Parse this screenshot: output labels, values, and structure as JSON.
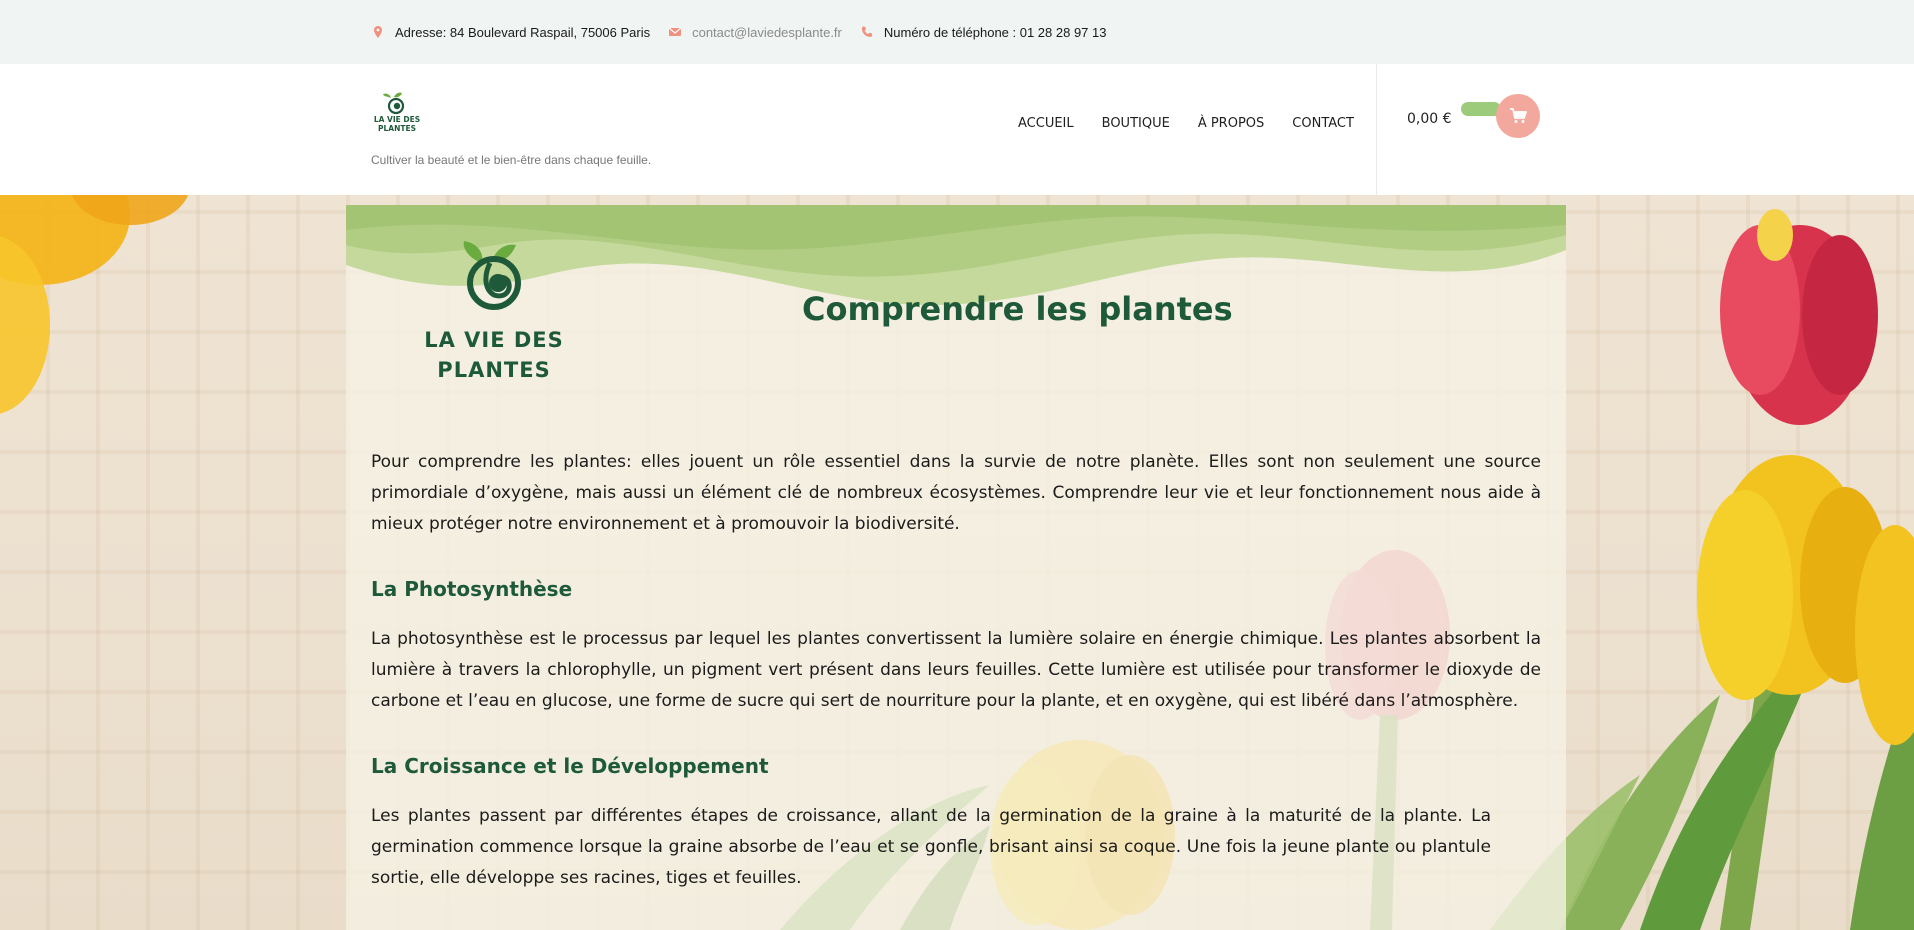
{
  "topbar": {
    "address": "Adresse: 84 Boulevard Raspail, 75006 Paris",
    "email": "contact@laviedesplante.fr",
    "phone": "Numéro de téléphone : 01 28 28 97 13"
  },
  "header": {
    "logo_text": "LA VIE DES PLANTES",
    "tagline": "Cultiver la beauté et le bien-être dans chaque feuille.",
    "nav": [
      "ACCUEIL",
      "BOUTIQUE",
      "À PROPOS",
      "CONTACT"
    ],
    "cart_total": "0,00 €"
  },
  "page": {
    "logo_line1": "LA VIE DES",
    "logo_line2": "PLANTES",
    "title": "Comprendre les plantes",
    "intro": "Pour comprendre les plantes: elles jouent un rôle essentiel dans la survie de notre planète. Elles sont non seulement une source primordiale d’oxygène, mais aussi un élément clé de nombreux écosystèmes. Comprendre leur vie et leur fonctionnement nous aide à mieux protéger notre environnement et à promouvoir la biodiversité.",
    "sections": [
      {
        "heading": "La Photosynthèse",
        "text": "La photosynthèse est le processus par lequel les plantes convertissent la lumière solaire en énergie chimique. Les plantes absorbent la lumière à travers la chlorophylle, un pigment vert présent dans leurs feuilles. Cette lumière est utilisée pour transformer le dioxyde de carbone et l’eau en glucose, une forme de sucre qui sert de nourriture pour la plante, et en oxygène, qui est libéré dans l’atmosphère."
      },
      {
        "heading": "La Croissance et le Développement",
        "text": "Les plantes passent par différentes étapes de croissance, allant de la germination de la graine à la maturité de la plante. La germination commence lorsque la graine absorbe de l’eau et se gonfle, brisant ainsi sa coque. Une fois la jeune plante ou plantule sortie, elle développe ses racines, tiges et feuilles."
      }
    ]
  },
  "icons": {
    "address": "map-pin-icon",
    "email": "envelope-icon",
    "phone": "phone-icon",
    "cart": "cart-icon"
  },
  "colors": {
    "brand_green": "#1e5a3a",
    "accent_light_green": "#9ccb7b",
    "accent_salmon": "#f2a89c",
    "topbar_bg": "#f0f4f2"
  }
}
